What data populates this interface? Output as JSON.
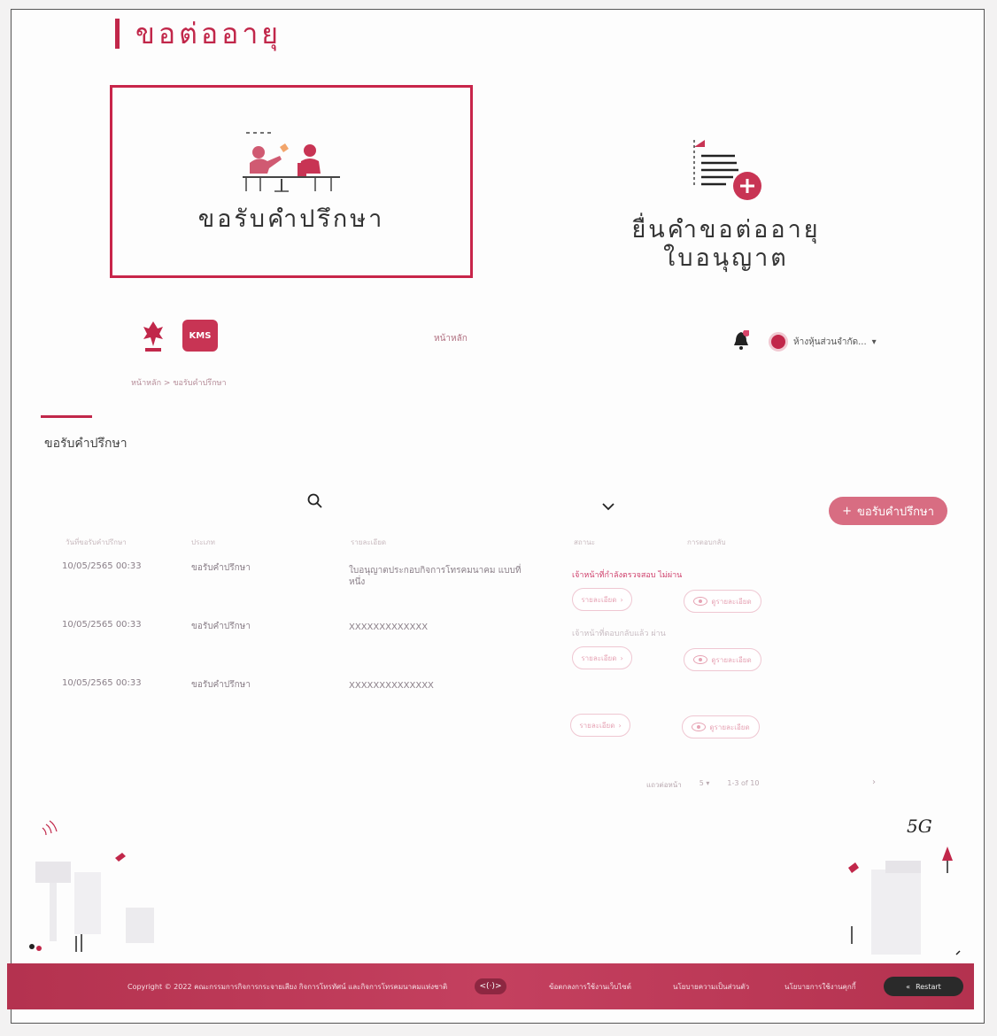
{
  "header": {
    "title": "ขอต่ออายุ"
  },
  "cards": [
    {
      "label": "ขอรับคำปรึกษา",
      "icon": "consultation-icon"
    },
    {
      "label_line1": "ยื่นคำขอต่ออายุ",
      "label_line2": "ใบอนุญาต",
      "icon": "document-add-icon"
    }
  ],
  "nav": {
    "logo_kms": "KMS",
    "home_link": "หน้าหลัก",
    "user_name": "ห้างหุ้นส่วนจำกัด...",
    "dropdown_caret": "▾"
  },
  "breadcrumb": {
    "home": "หน้าหลัก",
    "separator": ">",
    "current": "ขอรับคำปรึกษา"
  },
  "section": {
    "title": "ขอรับคำปรึกษา"
  },
  "actions": {
    "add_label": "ขอรับคำปรึกษา",
    "add_symbol": "+"
  },
  "table": {
    "headers": [
      "วันที่ขอรับคำปรึกษา",
      "ประเภท",
      "รายละเอียด",
      "สถานะ",
      "การตอบกลับ"
    ],
    "rows": [
      {
        "date": "10/05/2565  00:33",
        "type": "ขอรับคำปรึกษา",
        "desc": "ใบอนุญาตประกอบกิจการโทรคมนาคม แบบที่หนึ่ง",
        "status": "เจ้าหน้าที่กำลังตรวจสอบ  ไม่ผ่าน"
      },
      {
        "date": "10/05/2565  00:33",
        "type": "ขอรับคำปรึกษา",
        "desc": "XXXXXXXXXXXXX",
        "status": "เจ้าหน้าที่ตอบกลับแล้ว  ผ่าน"
      },
      {
        "date": "10/05/2565  00:33",
        "type": "ขอรับคำปรึกษา",
        "desc": "XXXXXXXXXXXXXX",
        "status": ""
      }
    ],
    "detail_label": "รายละเอียด",
    "view_label": "ดูรายละเอียด"
  },
  "pagination": {
    "rows_label": "แถวต่อหน้า",
    "rows_value": "5",
    "range": "1-3 of 10",
    "next": "›"
  },
  "footer": {
    "copyright": "Copyright © 2022 คณะกรรมการกิจการกระจายเสียง กิจการโทรทัศน์ และกิจการโทรคมนาคมแห่งชาติ",
    "code_toggle": "<(·)>",
    "link_terms": "ข้อตกลงการใช้งานเว็บไซต์",
    "link_privacy": "นโยบายความเป็นส่วนตัว",
    "link_cookies": "นโยบายการใช้งานคุกกี้",
    "restart": "Restart"
  },
  "decor": {
    "label_5g": "5G"
  },
  "colors": {
    "accent": "#c1274a",
    "footer": "#b4324f",
    "button": "#d86d82"
  }
}
